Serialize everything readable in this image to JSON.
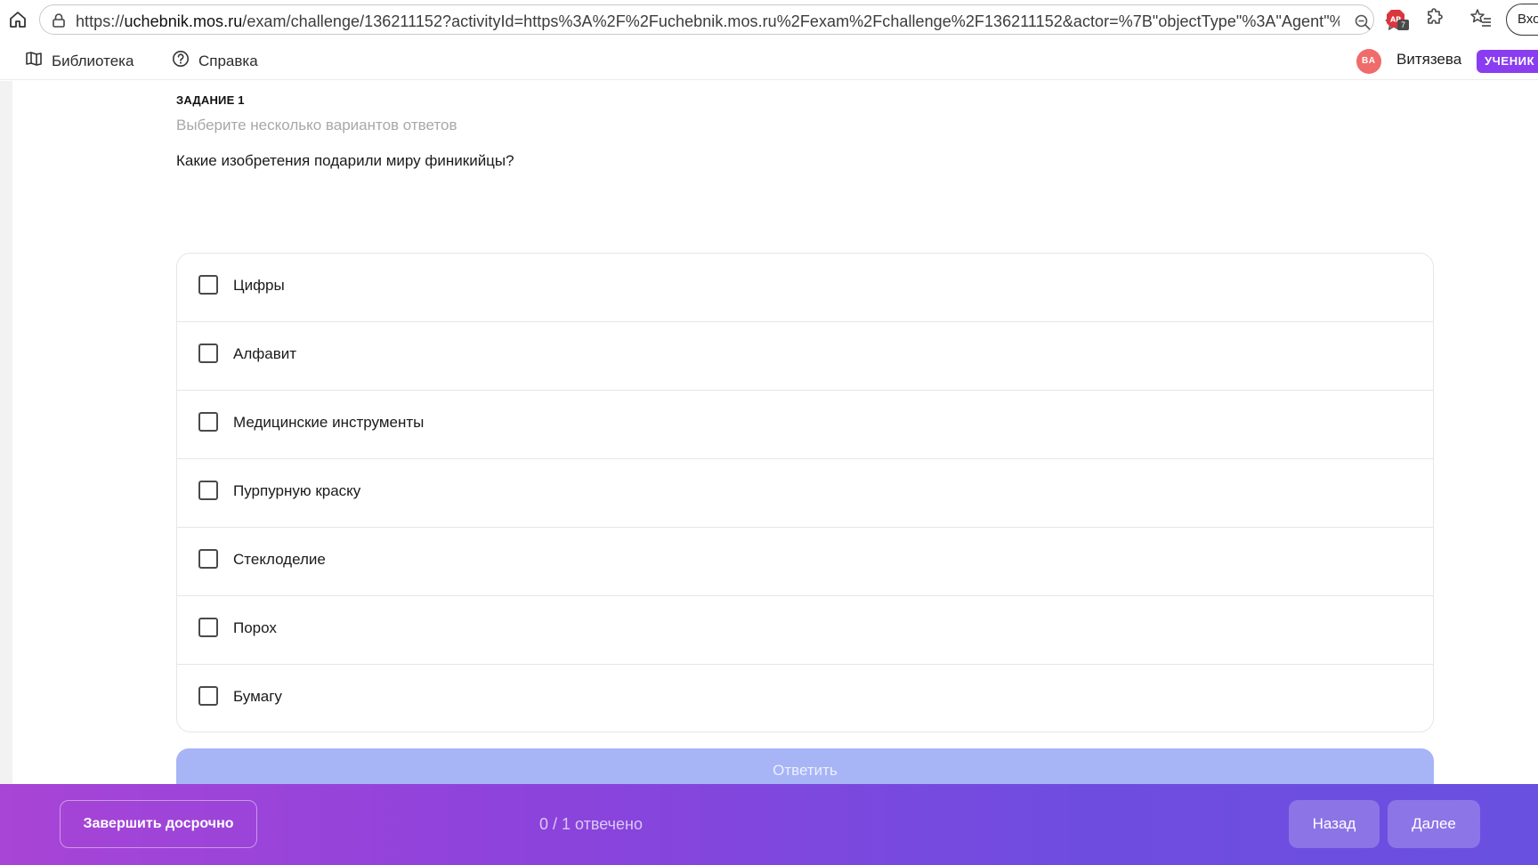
{
  "browser": {
    "url_host": "uchebnik.mos.ru",
    "url_prefix": "https://",
    "url_rest": "/exam/challenge/136211152?activityId=https%3A%2F%2Fuchebnik.mos.ru%2Fexam%2Fchallenge%2F136211152&actor=%7B\"objectType\"%3A\"Agent\"%...",
    "extension_badge": "7",
    "login_label": "Вход"
  },
  "header": {
    "library_label": "Библиотека",
    "help_label": "Справка",
    "avatar_initials": "ВА",
    "user_name": "Витязева",
    "role_badge": "УЧЕНИК"
  },
  "task": {
    "label": "ЗАДАНИЕ 1",
    "hint": "Выберите несколько вариантов ответов",
    "question": "Какие изобретения подарили миру финикийцы?",
    "options": [
      {
        "label": "Цифры",
        "checked": false
      },
      {
        "label": "Алфавит",
        "checked": false
      },
      {
        "label": "Медицинские инструменты",
        "checked": false
      },
      {
        "label": "Пурпурную краску",
        "checked": false
      },
      {
        "label": "Стеклоделие",
        "checked": false
      },
      {
        "label": "Порох",
        "checked": false
      },
      {
        "label": "Бумагу",
        "checked": false
      }
    ],
    "answer_label": "Ответить"
  },
  "footer": {
    "finish_label": "Завершить досрочно",
    "progress_text": "0 / 1 отвечено",
    "back_label": "Назад",
    "next_label": "Далее"
  },
  "colors": {
    "accent_purple": "#8a3df0",
    "answer_disabled": "#a7b4f6",
    "avatar": "#f06b6b",
    "footer_gradient_start": "#a844d6",
    "footer_gradient_end": "#6a50e0"
  }
}
